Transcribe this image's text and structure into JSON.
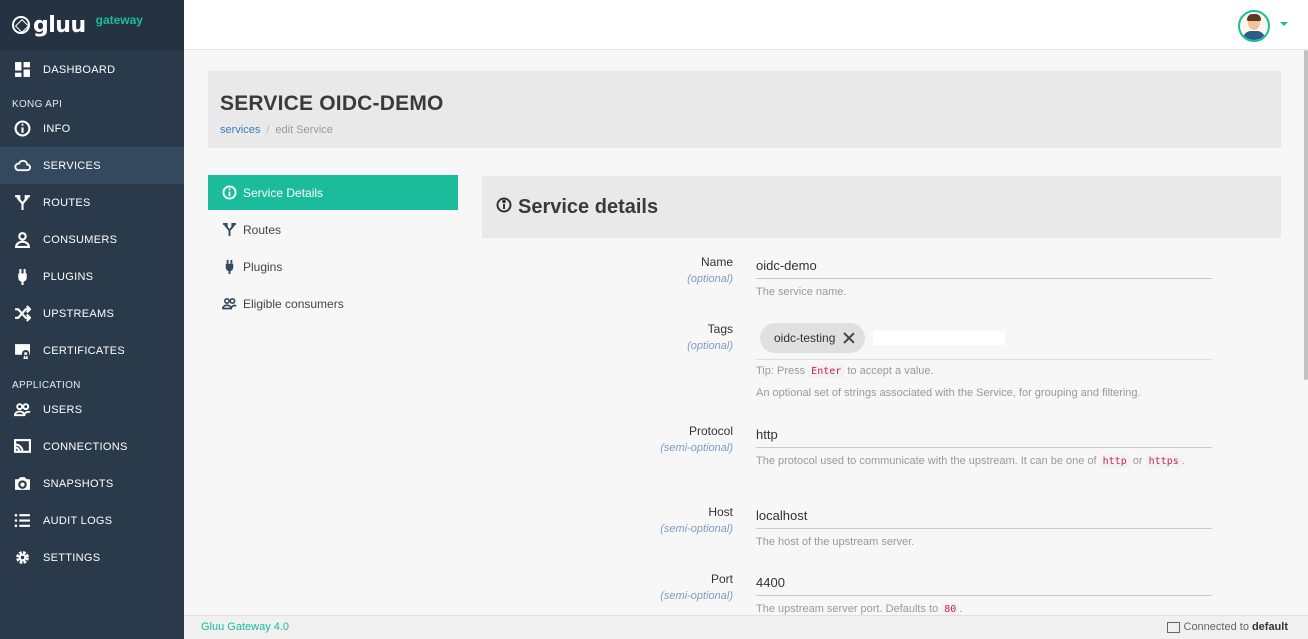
{
  "app": {
    "brand": "gluu",
    "brand_sub": "gateway"
  },
  "sidebar": {
    "dashboard": "DASHBOARD",
    "section_kong": "KONG API",
    "kong_items": [
      {
        "label": "INFO",
        "icon": "info-icon"
      },
      {
        "label": "SERVICES",
        "icon": "cloud-icon"
      },
      {
        "label": "ROUTES",
        "icon": "routes-icon"
      },
      {
        "label": "CONSUMERS",
        "icon": "user-icon"
      },
      {
        "label": "PLUGINS",
        "icon": "plug-icon"
      },
      {
        "label": "UPSTREAMS",
        "icon": "shuffle-icon"
      },
      {
        "label": "CERTIFICATES",
        "icon": "certificate-icon"
      }
    ],
    "section_app": "APPLICATION",
    "app_items": [
      {
        "label": "USERS",
        "icon": "users-icon"
      },
      {
        "label": "CONNECTIONS",
        "icon": "cast-icon"
      },
      {
        "label": "SNAPSHOTS",
        "icon": "camera-icon"
      },
      {
        "label": "AUDIT LOGS",
        "icon": "list-icon"
      },
      {
        "label": "SETTINGS",
        "icon": "gear-icon"
      }
    ],
    "active": "SERVICES"
  },
  "header": {
    "title": "SERVICE OIDC-DEMO",
    "breadcrumb": [
      "services",
      "edit Service"
    ]
  },
  "submenu": {
    "items": [
      "Service Details",
      "Routes",
      "Plugins",
      "Eligible consumers"
    ],
    "active": "Service Details"
  },
  "panel": {
    "title": "Service details"
  },
  "form": {
    "name": {
      "label": "Name",
      "qualifier": "(optional)",
      "value": "oidc-demo",
      "help": "The service name."
    },
    "tags": {
      "label": "Tags",
      "qualifier": "(optional)",
      "chips": [
        "oidc-testing"
      ],
      "tip_before": "Tip: Press",
      "tip_code": "Enter",
      "tip_after": "to accept a value.",
      "help": "An optional set of strings associated with the Service, for grouping and filtering."
    },
    "protocol": {
      "label": "Protocol",
      "qualifier": "(semi-optional)",
      "value": "http",
      "help_before": "The protocol used to communicate with the upstream. It can be one of",
      "help_code1": "http",
      "help_mid": "or",
      "help_code2": "https",
      "help_after": "."
    },
    "host": {
      "label": "Host",
      "qualifier": "(semi-optional)",
      "value": "localhost",
      "help": "The host of the upstream server."
    },
    "port": {
      "label": "Port",
      "qualifier": "(semi-optional)",
      "value": "4400",
      "help_before": "The upstream server port. Defaults to",
      "help_code": "80",
      "help_after": "."
    }
  },
  "footer": {
    "version": "Gluu Gateway 4.0",
    "connected_label": "Connected to",
    "connected_target": "default"
  },
  "colors": {
    "accent": "#1abc9c",
    "sidebar": "#2b3a4a"
  }
}
